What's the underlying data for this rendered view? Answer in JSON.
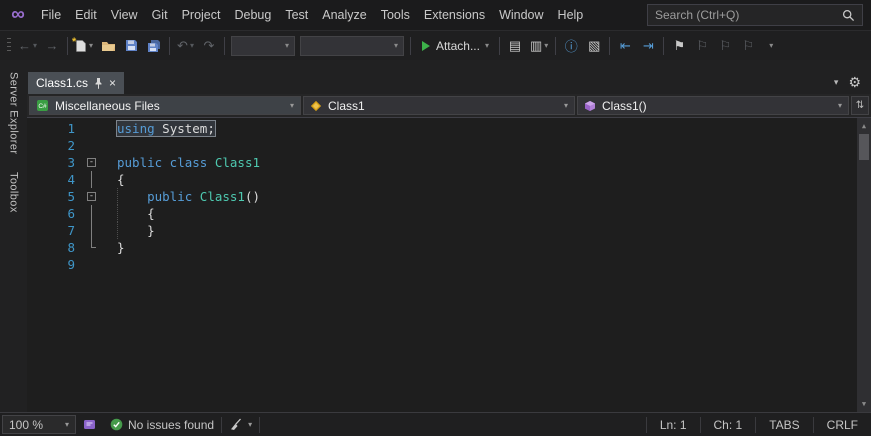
{
  "menubar": {
    "items": [
      "File",
      "Edit",
      "View",
      "Git",
      "Project",
      "Debug",
      "Test",
      "Analyze",
      "Tools",
      "Extensions",
      "Window",
      "Help"
    ],
    "search_placeholder": "Search (Ctrl+Q)"
  },
  "toolbar": {
    "attach_label": "Attach...",
    "config_combo_value": "",
    "platform_combo_value": ""
  },
  "side_tabs": {
    "server_explorer": "Server Explorer",
    "toolbox": "Toolbox"
  },
  "tab_bar": {
    "active_tab": "Class1.cs"
  },
  "navbar": {
    "project": "Miscellaneous Files",
    "type": "Class1",
    "member": "Class1()"
  },
  "editor": {
    "lines": [
      {
        "num": "1",
        "fold": "none",
        "selected": true,
        "tokens": [
          {
            "c": "kw",
            "t": "using"
          },
          {
            "c": "pl",
            "t": " System;"
          }
        ]
      },
      {
        "num": "2",
        "fold": "none",
        "tokens": []
      },
      {
        "num": "3",
        "fold": "minus",
        "tokens": [
          {
            "c": "kw",
            "t": "public class"
          },
          {
            "c": "pl",
            "t": " "
          },
          {
            "c": "cls",
            "t": "Class1"
          }
        ]
      },
      {
        "num": "4",
        "fold": "line",
        "tokens": [
          {
            "c": "pl",
            "t": "{"
          }
        ]
      },
      {
        "num": "5",
        "fold": "minus",
        "guides": [
          0
        ],
        "tokens": [
          {
            "c": "pl",
            "t": "    "
          },
          {
            "c": "kw",
            "t": "public "
          },
          {
            "c": "cls",
            "t": "Class1"
          },
          {
            "c": "pl",
            "t": "()"
          }
        ]
      },
      {
        "num": "6",
        "fold": "line",
        "guides": [
          0
        ],
        "tokens": [
          {
            "c": "pl",
            "t": "    {"
          }
        ]
      },
      {
        "num": "7",
        "fold": "line",
        "guides": [
          0
        ],
        "tokens": [
          {
            "c": "pl",
            "t": "    }"
          }
        ]
      },
      {
        "num": "8",
        "fold": "end",
        "tokens": [
          {
            "c": "pl",
            "t": "}"
          }
        ]
      },
      {
        "num": "9",
        "fold": "none",
        "tokens": []
      }
    ]
  },
  "status_bar": {
    "zoom": "100 %",
    "health": "No issues found",
    "line": "Ln: 1",
    "column": "Ch: 1",
    "tabs_mode": "TABS",
    "line_ending": "CRLF"
  },
  "icons": {
    "vs_logo": "∞",
    "back": "←",
    "forward": "→",
    "undo": "↶",
    "redo": "↷",
    "caret": "▾",
    "member_list": "▤",
    "param_info": "▥",
    "quick_info": "ⓘ",
    "word_completion": "▧",
    "indent_decrease": "⇤",
    "indent_increase": "⇥",
    "bookmark": "⚑",
    "bookmark_outline": "⚐",
    "overflow": "▾",
    "close": "×",
    "split": "⇅",
    "gear": "⚙",
    "scroll_up": "▲",
    "scroll_down": "▼",
    "new_file_star": "*"
  },
  "colors": {
    "keyword_blue": "#569cd6",
    "class_teal": "#4ec9b0",
    "line_number_blue": "#3f96c8",
    "selection_border": "#7d848c",
    "check_green": "#459a4a",
    "attach_green": "#3db14a",
    "method_purple": "#b180d7",
    "vs_purple": "#9a6fd0",
    "tab_active_bg": "#4a4f55"
  }
}
